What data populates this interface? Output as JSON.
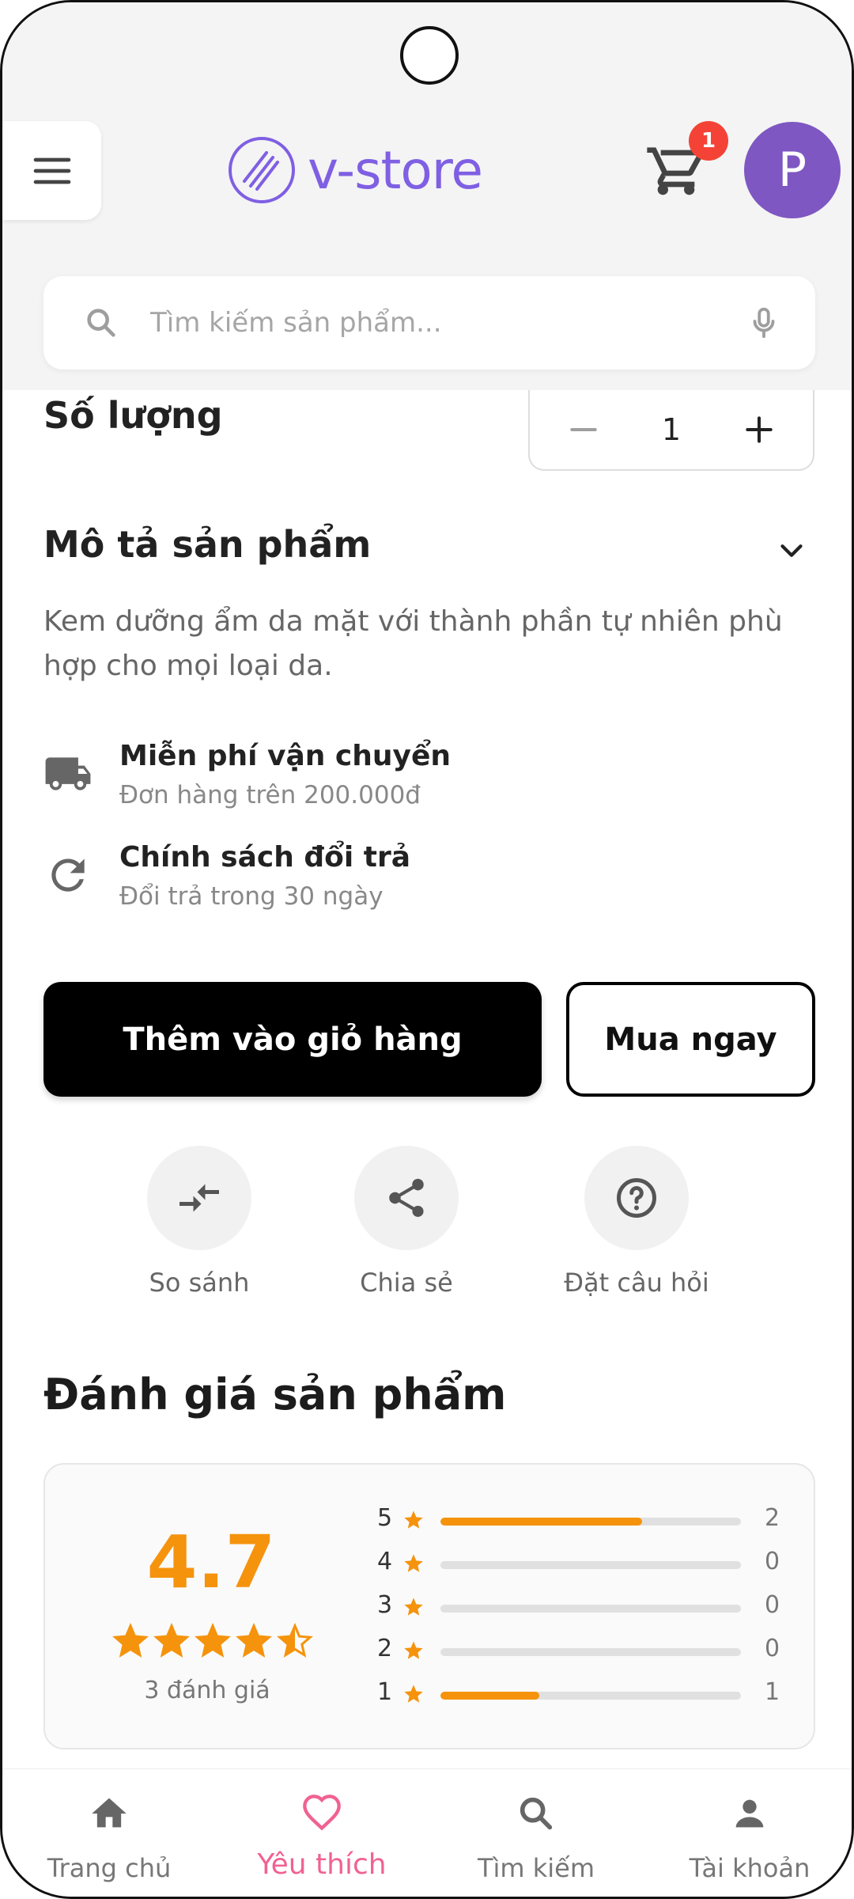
{
  "header": {
    "logo_text": "v-store",
    "cart_badge": "1",
    "avatar_initial": "P"
  },
  "search": {
    "placeholder": "Tìm kiếm sản phẩm..."
  },
  "quantity": {
    "label": "Số lượng",
    "value": "1"
  },
  "description": {
    "title": "Mô tả sản phẩm",
    "text": "Kem dưỡng ẩm da mặt với thành phần tự nhiên phù hợp cho mọi loại da."
  },
  "features": [
    {
      "icon": "truck-icon",
      "title": "Miễn phí vận chuyển",
      "subtitle": "Đơn hàng trên 200.000đ"
    },
    {
      "icon": "refresh-icon",
      "title": "Chính sách đổi trả",
      "subtitle": "Đổi trả trong 30 ngày"
    }
  ],
  "buttons": {
    "add_to_cart": "Thêm vào giỏ hàng",
    "buy_now": "Mua ngay"
  },
  "actions": [
    {
      "icon": "compare-icon",
      "label": "So sánh"
    },
    {
      "icon": "share-icon",
      "label": "Chia sẻ"
    },
    {
      "icon": "question-icon",
      "label": "Đặt câu hỏi"
    }
  ],
  "reviews": {
    "title": "Đánh giá sản phẩm",
    "average": "4.7",
    "rating_value": 4.7,
    "count_label": "3 đánh giá",
    "breakdown": [
      {
        "stars": "5",
        "count": "2",
        "fraction": 0.67
      },
      {
        "stars": "4",
        "count": "0",
        "fraction": 0
      },
      {
        "stars": "3",
        "count": "0",
        "fraction": 0
      },
      {
        "stars": "2",
        "count": "0",
        "fraction": 0
      },
      {
        "stars": "1",
        "count": "1",
        "fraction": 0.33
      }
    ]
  },
  "bottom_nav": [
    {
      "icon": "home-icon",
      "label": "Trang chủ",
      "active": false
    },
    {
      "icon": "heart-icon",
      "label": "Yêu thích",
      "active": true
    },
    {
      "icon": "search-icon",
      "label": "Tìm kiếm",
      "active": false
    },
    {
      "icon": "account-icon",
      "label": "Tài khoản",
      "active": false
    }
  ],
  "colors": {
    "brand": "#7f5fe3",
    "accent_star": "#f5930d",
    "badge": "#f44336",
    "avatar": "#7e57c2",
    "nav_active": "#f06292"
  }
}
